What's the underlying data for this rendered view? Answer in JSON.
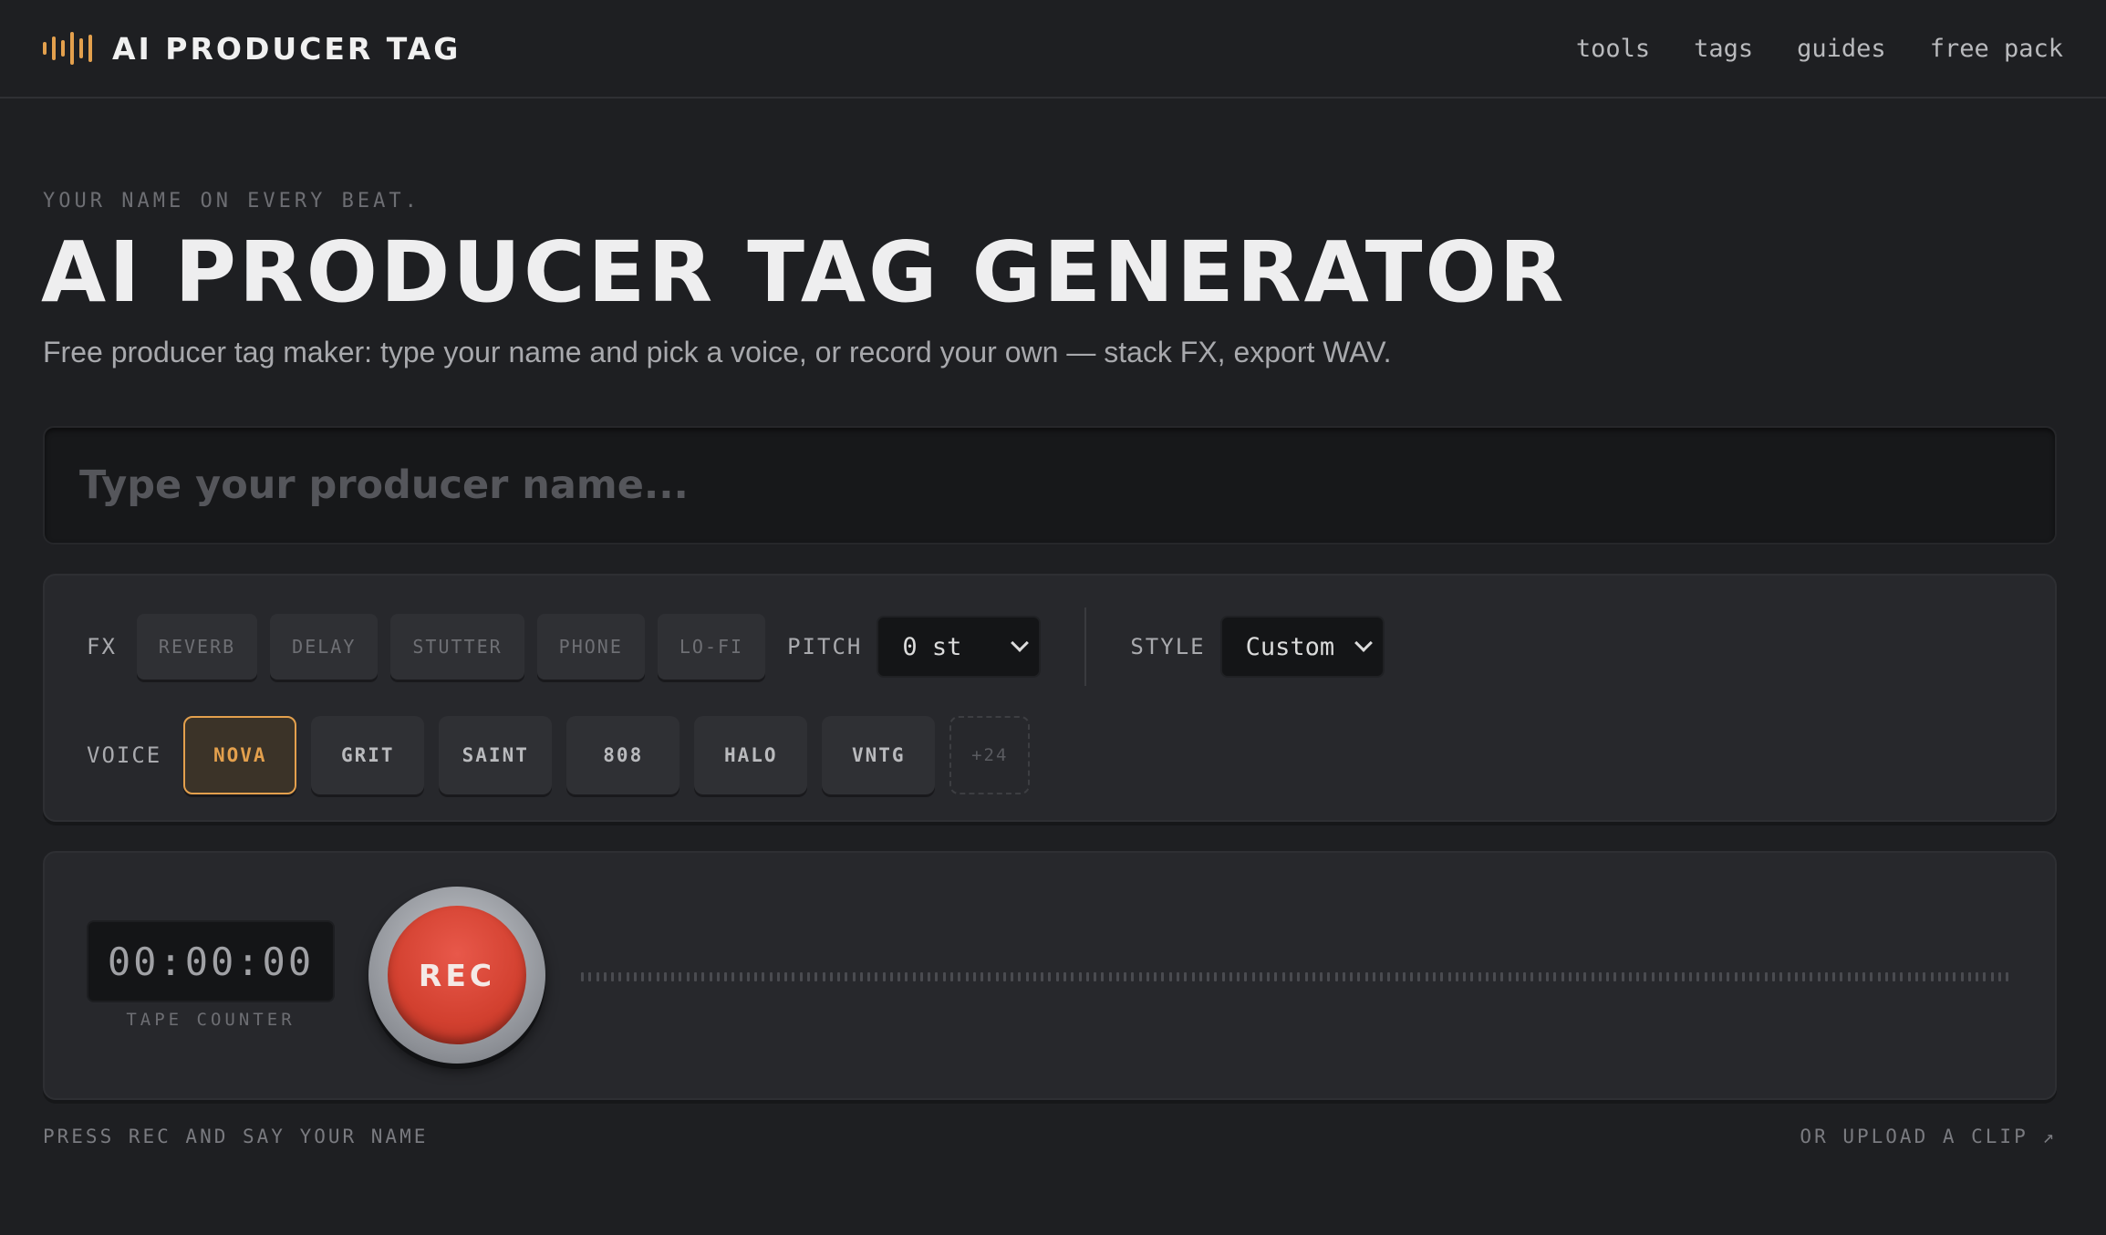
{
  "header": {
    "brand": "AI PRODUCER TAG",
    "nav": [
      "tools",
      "tags",
      "guides",
      "free pack"
    ]
  },
  "hero": {
    "eyebrow": "YOUR NAME ON EVERY BEAT.",
    "title": "AI PRODUCER TAG GENERATOR",
    "subtitle": "Free producer tag maker: type your name and pick a voice, or record your own — stack FX, export WAV."
  },
  "name_input": {
    "placeholder": "Type your producer name...",
    "value": ""
  },
  "fx": {
    "label": "FX",
    "chips": [
      "REVERB",
      "DELAY",
      "STUTTER",
      "PHONE",
      "LO-FI"
    ],
    "pitch_label": "PITCH",
    "pitch_value": "0 st",
    "style_label": "STYLE",
    "style_value": "Custom"
  },
  "voice": {
    "label": "VOICE",
    "options": [
      "NOVA",
      "GRIT",
      "SAINT",
      "808",
      "HALO",
      "VNTG"
    ],
    "selected": "NOVA",
    "more": "+24"
  },
  "recorder": {
    "counter": "00:00:00",
    "counter_label": "TAPE COUNTER",
    "rec_label": "REC"
  },
  "footer": {
    "hint": "PRESS REC AND SAY YOUR NAME",
    "upload": "OR UPLOAD A CLIP ↗"
  },
  "colors": {
    "background": "#1e1f22",
    "accent": "#e3a04d",
    "rec": "#d2402f"
  }
}
